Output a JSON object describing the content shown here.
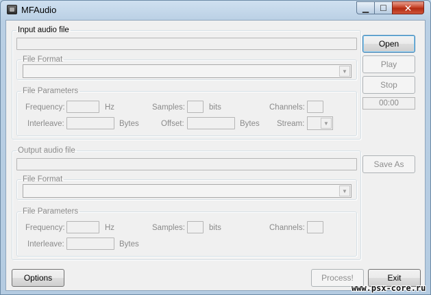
{
  "window": {
    "title": "MFAudio",
    "controls": {
      "minimize": "▁",
      "maximize": "☐",
      "close": "✕"
    }
  },
  "input": {
    "group_label": "Input audio file",
    "path_value": "",
    "format_label": "File Format",
    "format_value": "",
    "params_label": "File Parameters",
    "frequency_label": "Frequency:",
    "frequency_unit": "Hz",
    "samples_label": "Samples:",
    "samples_unit": "bits",
    "channels_label": "Channels:",
    "interleave_label": "Interleave:",
    "interleave_unit": "Bytes",
    "offset_label": "Offset:",
    "offset_unit": "Bytes",
    "stream_label": "Stream:"
  },
  "output": {
    "group_label": "Output audio file",
    "path_value": "",
    "format_label": "File Format",
    "format_value": "",
    "params_label": "File Parameters",
    "frequency_label": "Frequency:",
    "frequency_unit": "Hz",
    "samples_label": "Samples:",
    "samples_unit": "bits",
    "channels_label": "Channels:",
    "interleave_label": "Interleave:",
    "interleave_unit": "Bytes"
  },
  "buttons": {
    "open": "Open",
    "play": "Play",
    "stop": "Stop",
    "time": "00:00",
    "save_as": "Save As",
    "options": "Options",
    "process": "Process!",
    "exit": "Exit"
  },
  "watermark": "www.psx-core.ru",
  "icons": {
    "dropdown": "▼"
  }
}
